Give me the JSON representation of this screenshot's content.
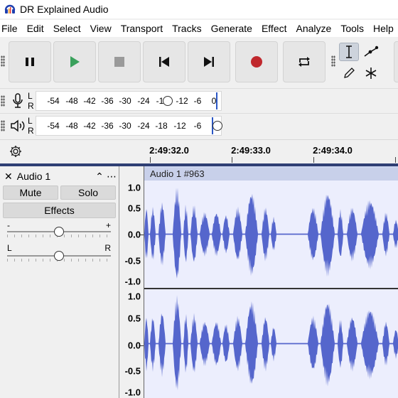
{
  "window": {
    "title": "DR Explained Audio"
  },
  "menu": [
    "File",
    "Edit",
    "Select",
    "View",
    "Transport",
    "Tracks",
    "Generate",
    "Effect",
    "Analyze",
    "Tools",
    "Help"
  ],
  "meters": {
    "record": {
      "channels": [
        "L",
        "R"
      ],
      "scale": [
        "-54",
        "-48",
        "-42",
        "-36",
        "-30",
        "-24",
        "-1",
        "-12",
        "-6",
        "0"
      ]
    },
    "playback": {
      "channels": [
        "L",
        "R"
      ],
      "scale": [
        "-54",
        "-48",
        "-42",
        "-36",
        "-30",
        "-24",
        "-18",
        "-12",
        "-6"
      ]
    }
  },
  "timeline": {
    "labels": [
      "2:49:32.0",
      "2:49:33.0",
      "2:49:34.0"
    ]
  },
  "track": {
    "name": "Audio 1",
    "mute_label": "Mute",
    "solo_label": "Solo",
    "effects_label": "Effects",
    "gain_minus": "-",
    "gain_plus": "+",
    "pan_left": "L",
    "pan_right": "R",
    "gain_value": 0.5,
    "pan_value": 0.5,
    "clip_title": "Audio 1 #963"
  },
  "amplitude_scale": [
    "1.0",
    "0.5",
    "0.0",
    "-0.5",
    "-1.0"
  ],
  "colors": {
    "waveform": "#5566cc",
    "record_button": "#c0282d",
    "play_button": "#3aa15c",
    "accent": "#2b57c5"
  }
}
